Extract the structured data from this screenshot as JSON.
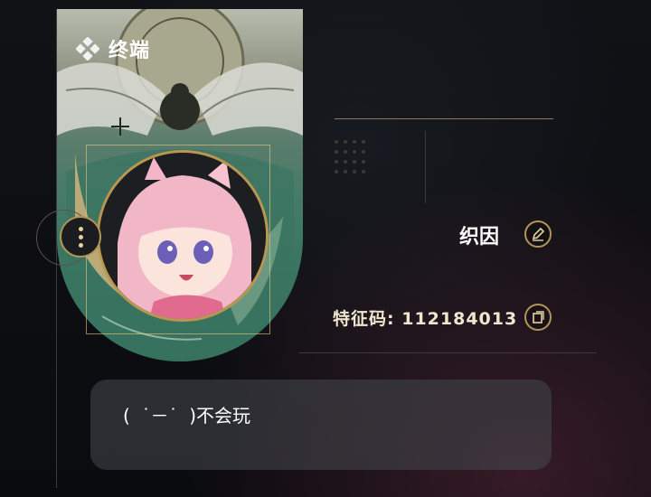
{
  "banner": {
    "label": "终端",
    "icon": "diamond-cluster-icon"
  },
  "profile": {
    "nickname": "织因",
    "uid_label": "特征码:",
    "uid_value": "112184013",
    "signature": "(  ˙－˙  )不会玩"
  },
  "icons": {
    "menu": "more-vertical-icon",
    "edit": "pen-icon",
    "copy": "copy-icon"
  },
  "colors": {
    "accent_gold": "#b29556",
    "banner_green": "#3f7a66",
    "background": "#0d0f13"
  }
}
